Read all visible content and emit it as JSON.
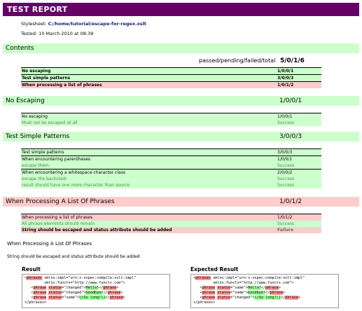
{
  "report": {
    "title": "TEST REPORT",
    "stylesheet_label": "Stylesheet:",
    "stylesheet_path": "C:/home/tutorial/escape-for-regex.xslt",
    "tested": "Tested: 10 March 2010 at 08:39"
  },
  "contents": {
    "heading": "Contents",
    "summary_label": "passed/pending/failed/total",
    "summary_value": "5/0/1/6",
    "rows": [
      {
        "label": "No escaping",
        "value": "1/0/0/1"
      },
      {
        "label": "Test simple patterns",
        "value": "3/0/0/3"
      },
      {
        "label": "When processing a list of phrases",
        "value": "1/0/1/2"
      }
    ]
  },
  "no_escaping": {
    "heading": "No Escaping",
    "total": "1/0/0/1",
    "rows": [
      {
        "label": "No escaping",
        "value": "1/0/0/1"
      },
      {
        "label": "Must not be escaped at all",
        "value": "Success"
      }
    ]
  },
  "simple_patterns": {
    "heading": "Test Simple Patterns",
    "total": "3/0/0/3",
    "rows": [
      {
        "label": "Test simple patterns",
        "value": "3/0/0/3"
      },
      {
        "label": "When encountering parentheses",
        "value": "1/0/0/1"
      },
      {
        "label": "escape them.",
        "value": "Success"
      },
      {
        "label": "When encountering a whitespace character class",
        "value": "2/0/0/2"
      },
      {
        "label": "escape the backslash",
        "value": "Success"
      },
      {
        "label": "result should have one more character than source",
        "value": "Success"
      }
    ]
  },
  "phrases": {
    "heading": "When Processing A List Of Phrases",
    "total": "1/0/1/2",
    "rows": [
      {
        "label": "When processing a list of phrases",
        "value": "1/0/1/2"
      },
      {
        "label": "All phrase elements should remain",
        "value": "Success"
      },
      {
        "label": "String should be escaped and status attribute should be added",
        "value": "Failure"
      }
    ]
  },
  "failure_detail": {
    "title": "When Processing A List Of Phrases",
    "description": "String should be escaped and status attribute should be added",
    "result_heading": "Result",
    "expected_heading": "Expected Result"
  },
  "result_code": {
    "l1_tag": "phrases",
    "l1_rest": " xmlns:impl=\"urn:x-xspec:compile:xslt:impl\"",
    "l2": "         xmlns:functx=\"http://www.functx.com\">",
    "phrase": "phrase",
    "status": "status",
    "p1_status": "\"changed\"",
    "p1_text": "Hello!",
    "p2_status": "\"changed\"",
    "p2_text": "Goodbye!",
    "p3_status": "\"same\"",
    "p3_text": "\\(So long!\\)",
    "close": "</phrases>"
  },
  "expected_code": {
    "l1_tag": "phrases",
    "l1_rest": " xmlns:impl=\"urn:x-xspec:compile:xslt:impl\"",
    "l2": "         xmlns:functx=\"http://www.functx.com\">",
    "phrase": "phrase",
    "status": "status",
    "p1_status": "\"same\"",
    "p1_text": "Hello!",
    "p2_status": "\"same\"",
    "p2_text": "Goodbye!",
    "p3_status": "\"changed\"",
    "p3_text": "\\(So long!\\)",
    "close": "</phrases>"
  }
}
